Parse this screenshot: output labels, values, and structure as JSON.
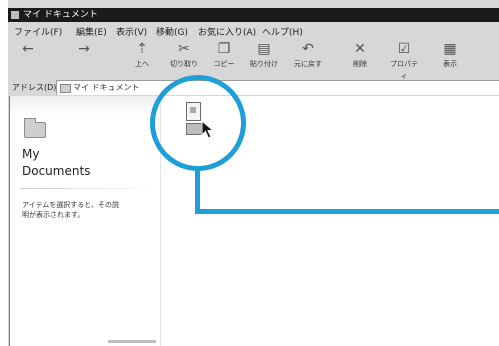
{
  "window": {
    "title": "マイ ドキュメント"
  },
  "menubar": {
    "items": [
      "ファイル(F)",
      "編集(E)",
      "表示(V)",
      "移動(G)",
      "お気に入り(A)",
      "ヘルプ(H)"
    ]
  },
  "toolbar": {
    "buttons": [
      {
        "label": "",
        "icon": "back-arrow-icon"
      },
      {
        "label": "",
        "icon": "forward-arrow-icon"
      },
      {
        "label": "上へ",
        "icon": "up-folder-icon"
      },
      {
        "label": "切り取り",
        "icon": "cut-icon"
      },
      {
        "label": "コピー",
        "icon": "copy-icon"
      },
      {
        "label": "貼り付け",
        "icon": "paste-icon"
      },
      {
        "label": "元に戻す",
        "icon": "undo-icon"
      },
      {
        "label": "削除",
        "icon": "delete-icon"
      },
      {
        "label": "プロパティ",
        "icon": "properties-icon"
      },
      {
        "label": "表示",
        "icon": "views-icon"
      }
    ]
  },
  "address": {
    "label": "アドレス(D)",
    "value": "マイ ドキュメント"
  },
  "left_pane": {
    "title_line1": "My",
    "title_line2": "Documents",
    "hint_line1": "アイテムを選択すると、その説",
    "hint_line2": "明が表示されます。"
  },
  "colors": {
    "callout": "#1e9fd8",
    "titlebar": "#1b1b1b"
  }
}
